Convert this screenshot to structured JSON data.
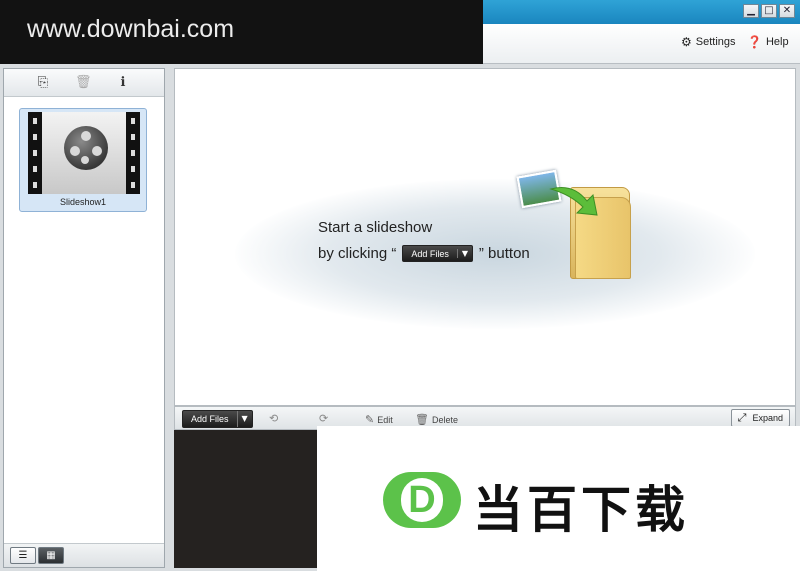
{
  "window": {
    "minimize_icon": "▁",
    "maximize_icon": "□",
    "close_icon": "✕"
  },
  "toolbar": {
    "settings_label": "Settings",
    "help_label": "Help"
  },
  "watermark_top": {
    "text": "www.downbai.com"
  },
  "left_panel": {
    "tools": [
      "add-slideshow-icon",
      "trash-icon",
      "info-icon"
    ],
    "items": [
      {
        "label": "Slideshow1",
        "icon": "film-reel-icon"
      }
    ]
  },
  "preview": {
    "hint_line1": "Start a slideshow",
    "hint_line2_prefix": "by clicking “",
    "hint_button": "Add Files",
    "hint_line2_suffix": "” button"
  },
  "filestrip": {
    "add_files_label": "Add Files",
    "edit_label": "Edit",
    "delete_label": "Delete",
    "expand_label": "Expand"
  },
  "watermark_bottom": {
    "logo_letter": "D",
    "text": "当百下载"
  },
  "colors": {
    "titlebar": "#1a86bf",
    "selected_item": "#d6e6f6",
    "logo_green": "#5cc24a"
  }
}
